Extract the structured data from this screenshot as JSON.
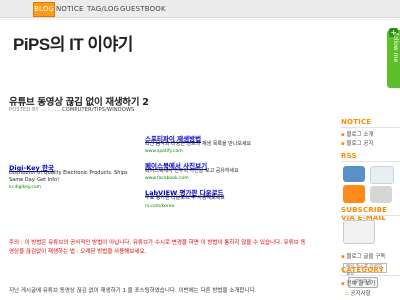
{
  "nav": {
    "items": [
      {
        "label": "BLOG",
        "active": true
      },
      {
        "label": "NOTICE",
        "active": false
      },
      {
        "label": "TAG/LOG",
        "active": false
      },
      {
        "label": "GUESTBOOK",
        "active": false
      }
    ]
  },
  "header": {
    "title": "PiPS의 IT 이야기"
  },
  "side_tab": {
    "plus": "+",
    "label": "follow me"
  },
  "post": {
    "title": "유튜브 동영상 끊김 없이 재생하기 2",
    "meta_prefix": "POSTED BY ... ... ...",
    "category": "COMPUTER/TIPS/WINDOWS",
    "ads": [
      {
        "title": "스포티파이 재생방법",
        "desc": "최신 음악과 다양한 장르의 재생 목록을 만나보세요",
        "url": "www.spotify.com"
      },
      {
        "title": "페이스북에서 사진보기",
        "desc": "페이스북에서 친구의 사진을 보고 공유하세요",
        "url": "www.facebook.com"
      },
      {
        "title": "Digi-Key 한국",
        "desc": "Distributor of Quality Electronic Products. Ships Same Day. Get Info!",
        "url": "kr.digikey.com"
      },
      {
        "title": "LabVIEW 평가판 다운로드",
        "desc": "무료 평가판 다운로드 후 사용해보세요",
        "url": "ni.com/korea"
      }
    ],
    "notice_red": "주의 : 이 방법은 유튜브의 공식적인 방법이 아닙니다. 유튜브가 수시로 변경을 하면 이 방법이 통하지 않을 수 있습니다. 유튜브 동영상을 끊김없이 재생하는 법 : 오래된 방법을 사용해보세요.",
    "body_text": "지난 게시글에 유튜브 동영상 끊김 없이 재생하기 1 을 포스팅하였습니다. 이번에는 다른 방법을 소개합니다."
  },
  "sidebar": {
    "notice": {
      "head": "NOTICE",
      "items": [
        "블로그 소개",
        "블로그 공지"
      ]
    },
    "rss": {
      "head": "RSS"
    },
    "subscribe": {
      "head": "SUBSCRIBE VIA E-MAIL",
      "input_value": "메일 주소를 입력하세요",
      "button": "구독하기"
    },
    "subscribe_item": "블로그 글을 구독",
    "category": {
      "head": "CATEGORY",
      "items": [
        "전체 글 보기",
        "공지사항"
      ]
    }
  },
  "colors": {
    "accent": "#ff8a00",
    "nav_active": "#ff9a16",
    "side_tab": "#5fbf2a",
    "link": "#0000cc",
    "notice_red": "#dd0000"
  }
}
